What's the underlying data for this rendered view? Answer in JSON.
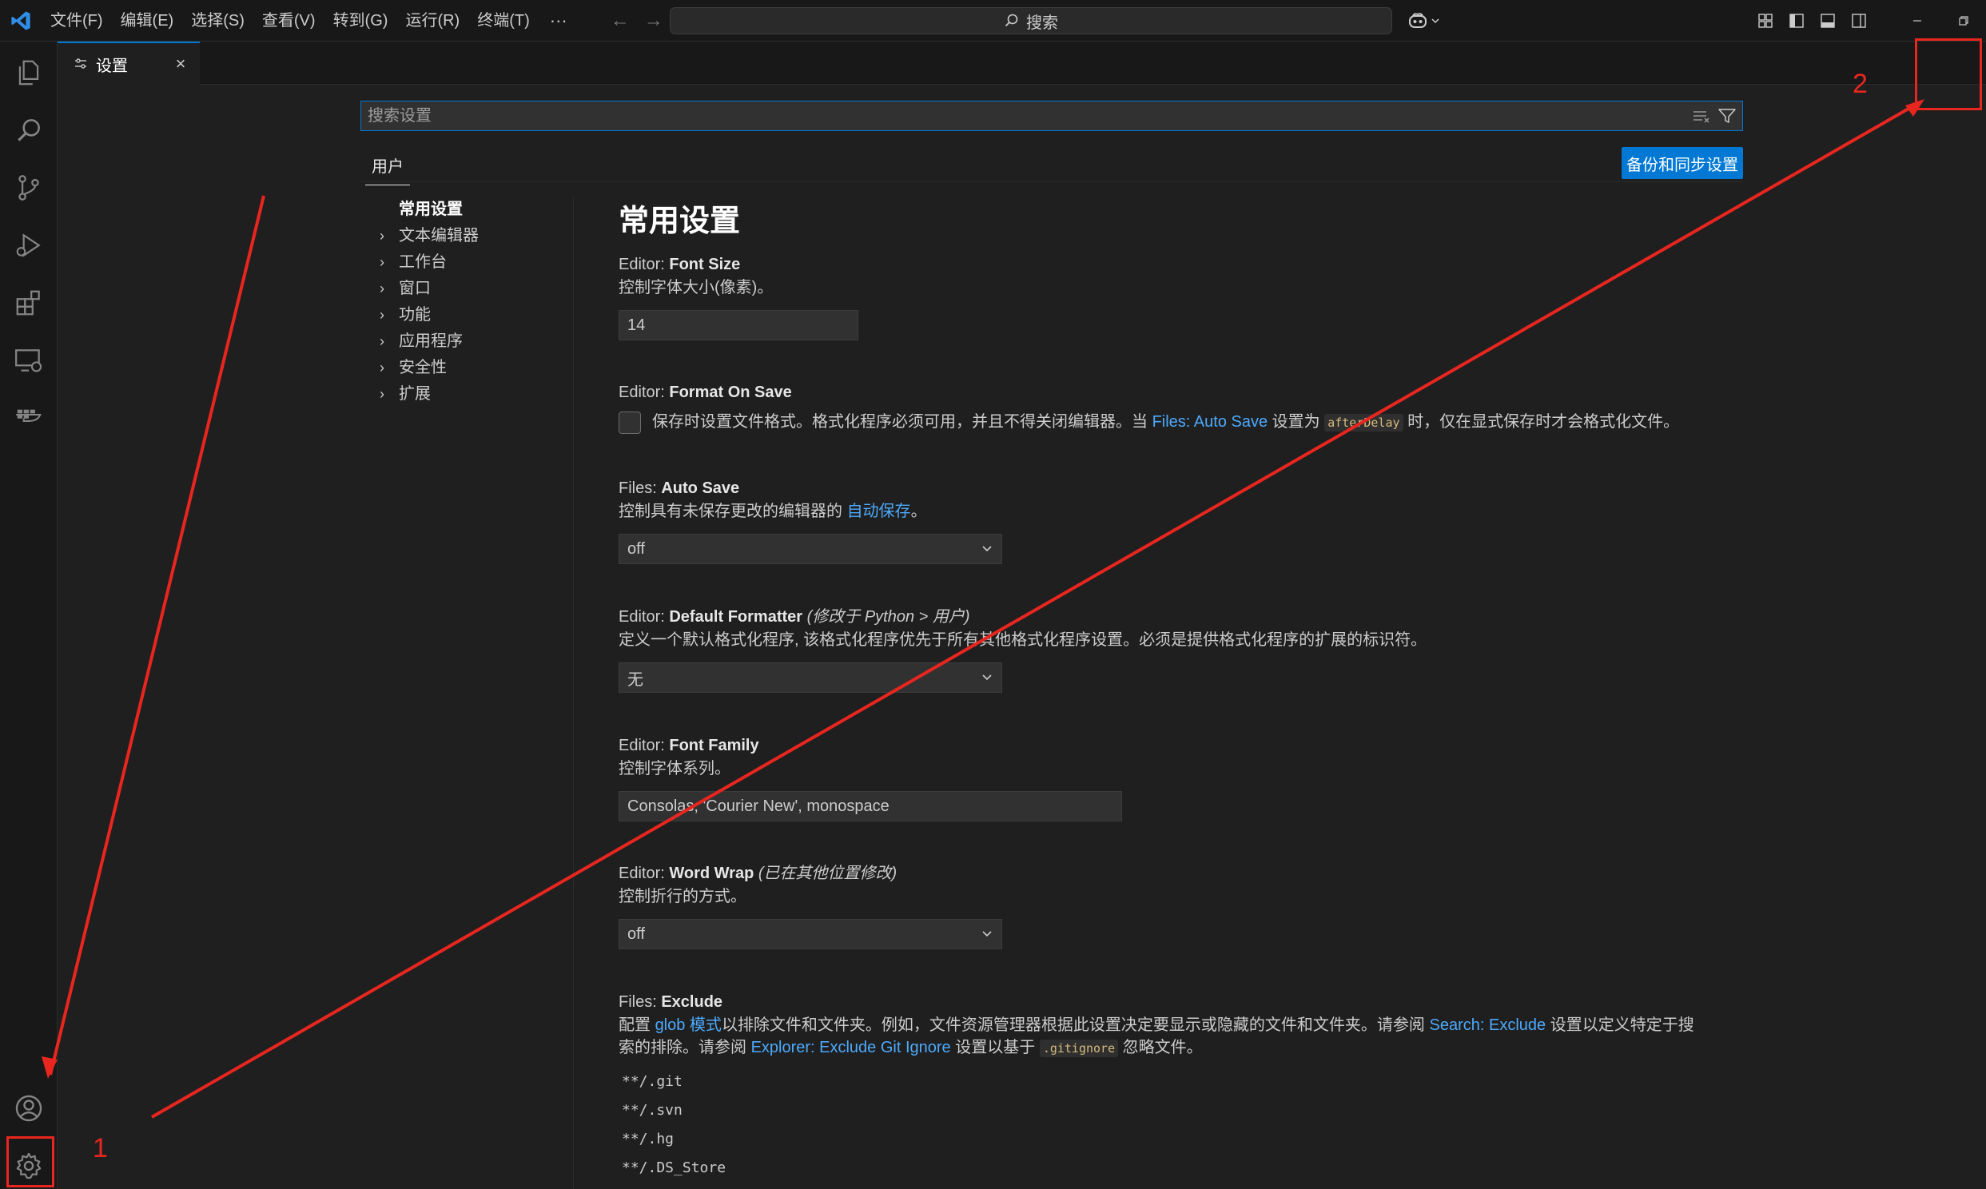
{
  "titlebar": {
    "menu": [
      "文件(F)",
      "编辑(E)",
      "选择(S)",
      "查看(V)",
      "转到(G)",
      "运行(R)",
      "终端(T)"
    ],
    "more": "···",
    "search_label": "搜索"
  },
  "tabs": [
    {
      "label": "设置"
    }
  ],
  "settings_editor": {
    "search_placeholder": "搜索设置",
    "scope_tab": "用户",
    "sync_button": "备份和同步设置",
    "toc": [
      {
        "label": "常用设置",
        "active": true
      },
      {
        "label": "文本编辑器"
      },
      {
        "label": "工作台"
      },
      {
        "label": "窗口"
      },
      {
        "label": "功能"
      },
      {
        "label": "应用程序"
      },
      {
        "label": "安全性"
      },
      {
        "label": "扩展"
      }
    ],
    "section_title": "常用设置",
    "settings": {
      "font_size": {
        "category": "Editor: ",
        "name": "Font Size",
        "desc": "控制字体大小(像素)。",
        "value": "14"
      },
      "format_on_save": {
        "category": "Editor: ",
        "name": "Format On Save",
        "desc_1": "保存时设置文件格式。格式化程序必须可用，并且不得关闭编辑器。当 ",
        "desc_link": "Files: Auto Save",
        "desc_2": " 设置为 ",
        "desc_code": "afterDelay",
        "desc_3": " 时，仅在显式保存时才会格式化文件。",
        "checked": false
      },
      "auto_save": {
        "category": "Files: ",
        "name": "Auto Save",
        "desc_1": "控制具有未保存更改的编辑器的 ",
        "desc_link": "自动保存",
        "desc_2": "。",
        "value": "off"
      },
      "default_formatter": {
        "category": "Editor: ",
        "name": "Default Formatter",
        "modified_prefix": "(修改于 ",
        "modified_link": "Python > 用户",
        "modified_suffix": ")",
        "desc": "定义一个默认格式化程序, 该格式化程序优先于所有其他格式化程序设置。必须是提供格式化程序的扩展的标识符。",
        "value": "无"
      },
      "font_family": {
        "category": "Editor: ",
        "name": "Font Family",
        "desc": "控制字体系列。",
        "value": "Consolas, 'Courier New', monospace"
      },
      "word_wrap": {
        "category": "Editor: ",
        "name": "Word Wrap",
        "note": "(已在其他位置修改)",
        "desc": "控制折行的方式。",
        "value": "off"
      },
      "exclude": {
        "category": "Files: ",
        "name": "Exclude",
        "desc_1": "配置 ",
        "desc_link1": "glob 模式",
        "desc_2": "以排除文件和文件夹。例如，文件资源管理器根据此设置决定要显示或隐藏的文件和文件夹。请参阅 ",
        "desc_link2": "Search: Exclude",
        "desc_3": " 设置以定义特定于搜索的排除。请参阅 ",
        "desc_link3": "Explorer: Exclude Git Ignore",
        "desc_4": " 设置以基于 ",
        "desc_code": ".gitignore",
        "desc_5": " 忽略文件。",
        "items": [
          "**/.git",
          "**/.svn",
          "**/.hg",
          "**/.DS_Store"
        ]
      }
    }
  },
  "annotations": {
    "label_1": "1",
    "label_2": "2",
    "color": "#e8261f"
  },
  "icons": {
    "activity": [
      "explorer-icon",
      "search-icon",
      "source-control-icon",
      "run-debug-icon",
      "extensions-icon",
      "remote-explorer-icon",
      "docker-icon",
      "account-icon",
      "manage-gear-icon"
    ],
    "open_settings_json": "open-settings-json-icon"
  },
  "colors": {
    "accent": "#0078d4",
    "link": "#4daafc",
    "background": "#1f1f1f",
    "sidebar": "#181818"
  }
}
